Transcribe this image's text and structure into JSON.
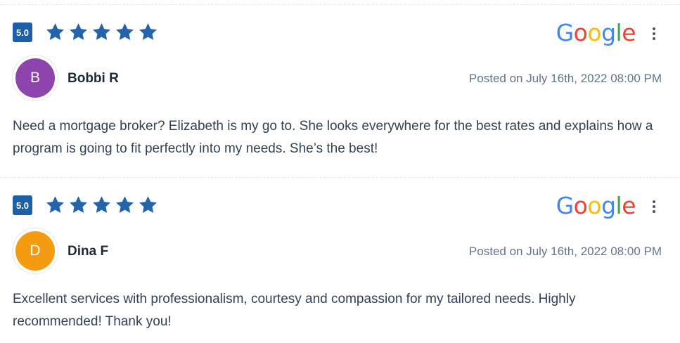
{
  "reviews": [
    {
      "score": "5.0",
      "rating": 5,
      "platform_icon": "google-logo",
      "author": "Bobbi R",
      "initial": "B",
      "avatar_color": "#8e44ad",
      "date": "Posted on July 16th, 2022 08:00 PM",
      "text": "Need a mortgage broker? Elizabeth is my go to. She looks everywhere for the best rates and explains how a program is going to fit perfectly into my needs. She’s the best!"
    },
    {
      "score": "5.0",
      "rating": 5,
      "platform_icon": "google-logo",
      "author": "Dina F",
      "initial": "D",
      "avatar_color": "#f39c12",
      "date": "Posted on July 16th, 2022 08:00 PM",
      "text": "Excellent services with professionalism, courtesy and compassion for my tailored needs. Highly recommended! Thank you!"
    }
  ],
  "google": {
    "letters": [
      "G",
      "o",
      "o",
      "g",
      "l",
      "e"
    ]
  },
  "colors": {
    "star": "#2563aa",
    "badge": "#1f5fa8"
  }
}
